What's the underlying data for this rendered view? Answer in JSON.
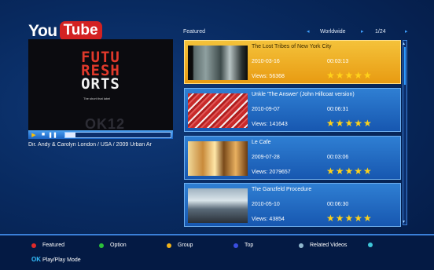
{
  "logo": {
    "you": "You",
    "tube": "Tube"
  },
  "preview": {
    "title_lines": [
      "FUTU",
      "RESH",
      "ORTS"
    ],
    "tagline": "The short that label",
    "ghost_text": "OK12",
    "caption": "Dir. Andy & Carolyn London / USA / 2009 Urban Ar",
    "progress_fraction": 0.1
  },
  "list_header": {
    "category": "Featured",
    "region": "Worldwide",
    "page": "1/24"
  },
  "videos": [
    {
      "title": "The Lost Tribes of New York City",
      "date": "2010-03-16",
      "duration": "00:03:13",
      "views": "Views: 56368",
      "stars": "★★★★★",
      "selected": true
    },
    {
      "title": "Unkle 'The Answer' (John Hillcoat version)",
      "date": "2010-09-07",
      "duration": "00:06:31",
      "views": "Views: 141643",
      "stars": "★★★★★",
      "selected": false
    },
    {
      "title": "Le Cafe",
      "date": "2009-07-28",
      "duration": "00:03:06",
      "views": "Views: 2079657",
      "stars": "★★★★★",
      "selected": false
    },
    {
      "title": "The Ganzfeld Procedure",
      "date": "2010-05-10",
      "duration": "00:06:30",
      "views": "Views: 43854",
      "stars": "★★★★★",
      "selected": false
    }
  ],
  "legend": {
    "red": "Featured",
    "green": "Option",
    "yellow": "Group",
    "blue": "Top",
    "related": "Related Videos",
    "ok_key": "OK",
    "ok_text": "Play/Play Mode"
  },
  "colors": {
    "red_key": "#e02a2a",
    "green_key": "#2bbf3a",
    "yellow_key": "#f0b21a",
    "blue_key": "#3a4ee0",
    "related_key": "#8fb6cc",
    "search_key": "#3fc7d9"
  }
}
